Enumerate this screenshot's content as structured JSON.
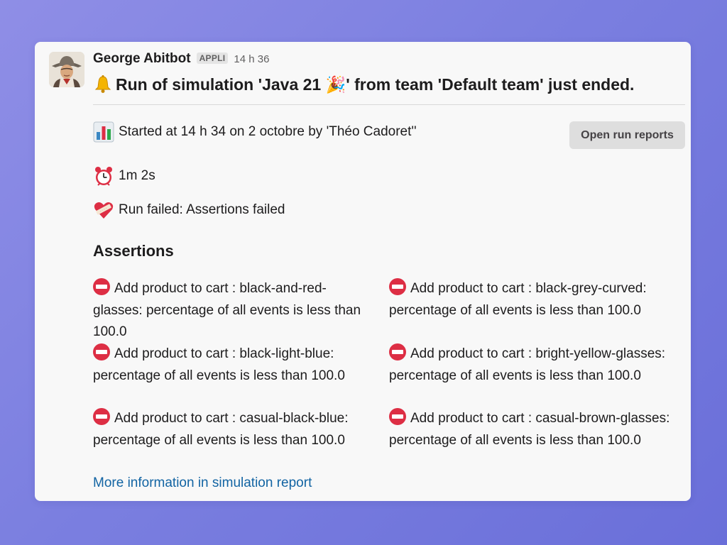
{
  "message": {
    "sender": "George Abitbot",
    "badge": "APPLI",
    "timestamp": "14 h 36",
    "headline": "Run of simulation 'Java 21 🎉' from team 'Default team' just ended.",
    "started": "Started at 14 h 34 on 2 octobre by 'Théo Cadoret''",
    "duration": "1m 2s",
    "status": "Run failed: Assertions failed",
    "open_button": "Open run reports",
    "assertions_title": "Assertions",
    "assertions": [
      {
        "text": "Add product to cart : black-and-red-glasses: percentage of all events is less than 100.0"
      },
      {
        "text": "Add product to cart : black-grey-curved: percentage of all events is less than 100.0"
      },
      {
        "text": "Add product to cart : black-light-blue: percentage of all events is less than 100.0"
      },
      {
        "text": "Add product to cart : bright-yellow-glasses: percentage of all events is less than 100.0"
      },
      {
        "text": "Add product to cart : casual-black-blue: percentage of all events is less than 100.0"
      },
      {
        "text": "Add product to cart : casual-brown-glasses: percentage of all events is less than 100.0"
      }
    ],
    "more_link": "More information in simulation report"
  },
  "icons": {
    "bell": "bell-icon",
    "chart": "bar-chart-icon",
    "clock": "alarm-clock-icon",
    "status": "mending-heart-icon",
    "assertion": "no-entry-icon"
  },
  "colors": {
    "background": "#7b7fe0",
    "card": "#f8f8f8",
    "link": "#1264a3",
    "no_entry": "#dd2e44"
  }
}
